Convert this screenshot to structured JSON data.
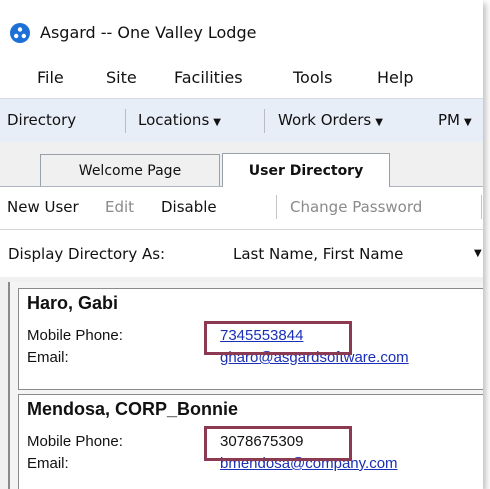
{
  "window": {
    "title": "Asgard -- One Valley Lodge"
  },
  "menu": [
    "File",
    "Site",
    "Facilities",
    "Tools",
    "Help"
  ],
  "toolbar": {
    "directory": "Directory",
    "locations": "Locations",
    "work_orders": "Work Orders",
    "pm": "PM"
  },
  "tabs": [
    {
      "label": "Welcome Page",
      "active": false
    },
    {
      "label": "User Directory",
      "active": true
    }
  ],
  "actions": {
    "new_user": "New User",
    "edit": "Edit",
    "disable": "Disable",
    "change_password": "Change Password"
  },
  "display": {
    "label": "Display Directory As:",
    "value": "Last Name, First Name"
  },
  "users": [
    {
      "name": "Haro, Gabi",
      "mobile_label": "Mobile Phone:",
      "mobile": "7345553844",
      "email_label": "Email:",
      "email": "gharo@asgardsoftware.com"
    },
    {
      "name": "Mendosa, CORP_Bonnie",
      "mobile_label": "Mobile Phone:",
      "mobile": "3078675309",
      "email_label": "Email:",
      "email": "bmendosa@company.com"
    }
  ],
  "colors": {
    "highlight": "#8b3a52",
    "link": "#1a2fb8",
    "toolbar": "#e8eef8",
    "app_icon": "#1e6fd6"
  }
}
